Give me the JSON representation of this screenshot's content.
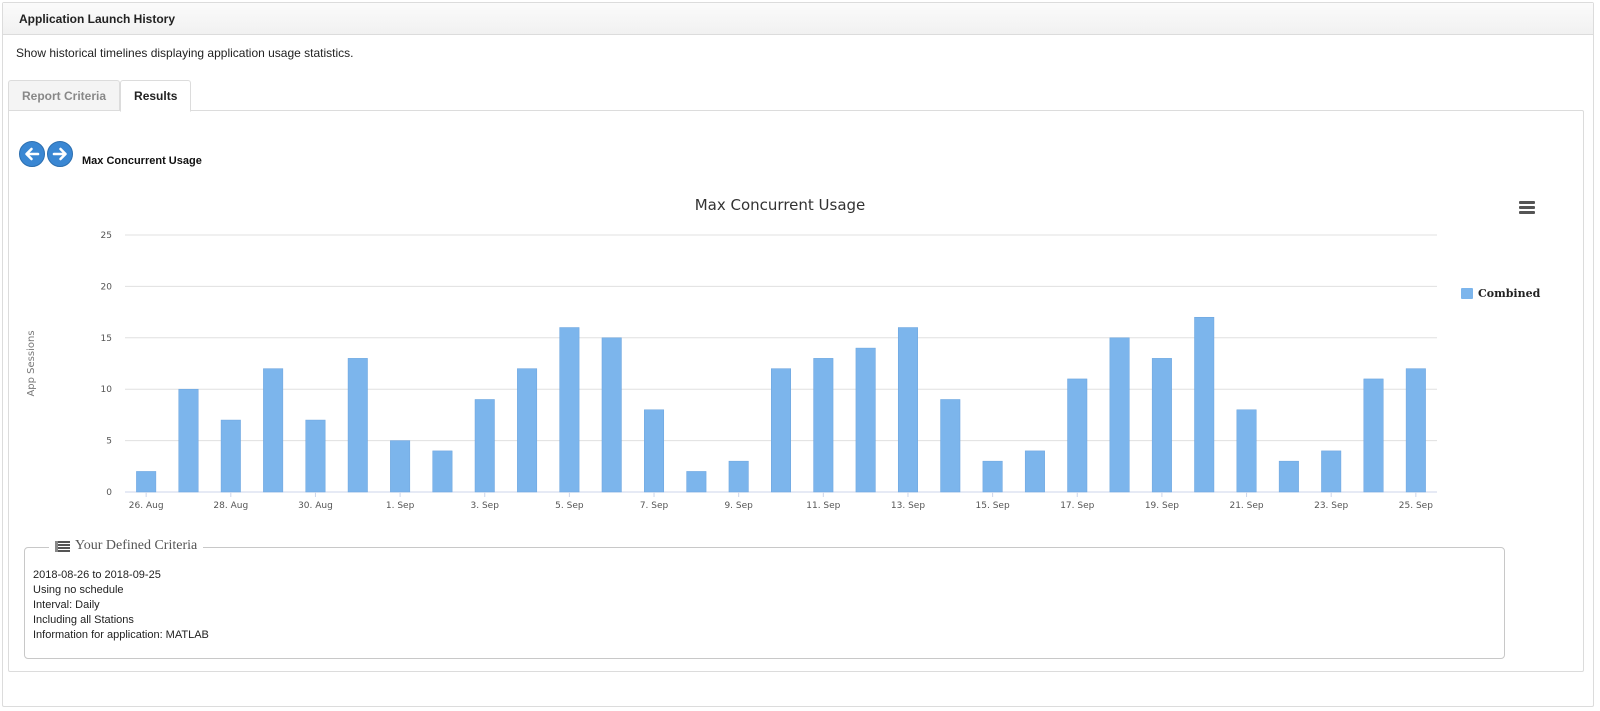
{
  "header": {
    "title": "Application Launch History"
  },
  "description": "Show historical timelines displaying application usage statistics.",
  "tabs": [
    {
      "label": "Report Criteria",
      "active": false
    },
    {
      "label": "Results",
      "active": true
    }
  ],
  "nav": {
    "title": "Max Concurrent Usage",
    "prev_icon": "arrow-left-circle-icon",
    "next_icon": "arrow-right-circle-icon"
  },
  "chart_menu_icon": "hamburger-menu-icon",
  "colors": {
    "bar": "#7cb5ec",
    "nav_button": "#3a87d3",
    "grid": "#e0e0e0"
  },
  "chart_data": {
    "type": "bar",
    "title": "Max Concurrent Usage",
    "ylabel": "App Sessions",
    "xlabel": "",
    "ylim": [
      0,
      25
    ],
    "yticks": [
      0,
      5,
      10,
      15,
      20,
      25
    ],
    "x": [
      "2018-08-26",
      "2018-08-27",
      "2018-08-28",
      "2018-08-29",
      "2018-08-30",
      "2018-08-31",
      "2018-09-01",
      "2018-09-02",
      "2018-09-03",
      "2018-09-04",
      "2018-09-05",
      "2018-09-06",
      "2018-09-07",
      "2018-09-08",
      "2018-09-09",
      "2018-09-10",
      "2018-09-11",
      "2018-09-12",
      "2018-09-13",
      "2018-09-14",
      "2018-09-15",
      "2018-09-16",
      "2018-09-17",
      "2018-09-18",
      "2018-09-19",
      "2018-09-20",
      "2018-09-21",
      "2018-09-22",
      "2018-09-23",
      "2018-09-24",
      "2018-09-25"
    ],
    "xtick_labels": [
      "26. Aug",
      "28. Aug",
      "30. Aug",
      "1. Sep",
      "3. Sep",
      "5. Sep",
      "7. Sep",
      "9. Sep",
      "11. Sep",
      "13. Sep",
      "15. Sep",
      "17. Sep",
      "19. Sep",
      "21. Sep",
      "23. Sep",
      "25. Sep"
    ],
    "series": [
      {
        "name": "Combined",
        "values": [
          2,
          10,
          7,
          12,
          7,
          13,
          5,
          4,
          9,
          12,
          16,
          15,
          8,
          2,
          3,
          12,
          13,
          14,
          16,
          9,
          3,
          4,
          11,
          15,
          13,
          17,
          8,
          3,
          4,
          11,
          12
        ]
      }
    ],
    "legend": {
      "position": "right"
    },
    "grid": true
  },
  "criteria": {
    "title": "Your Defined Criteria",
    "icon": "list-icon",
    "lines": [
      "2018-08-26 to 2018-09-25",
      "Using no schedule",
      "Interval: Daily",
      "Including all Stations",
      "Information for application: MATLAB"
    ]
  }
}
